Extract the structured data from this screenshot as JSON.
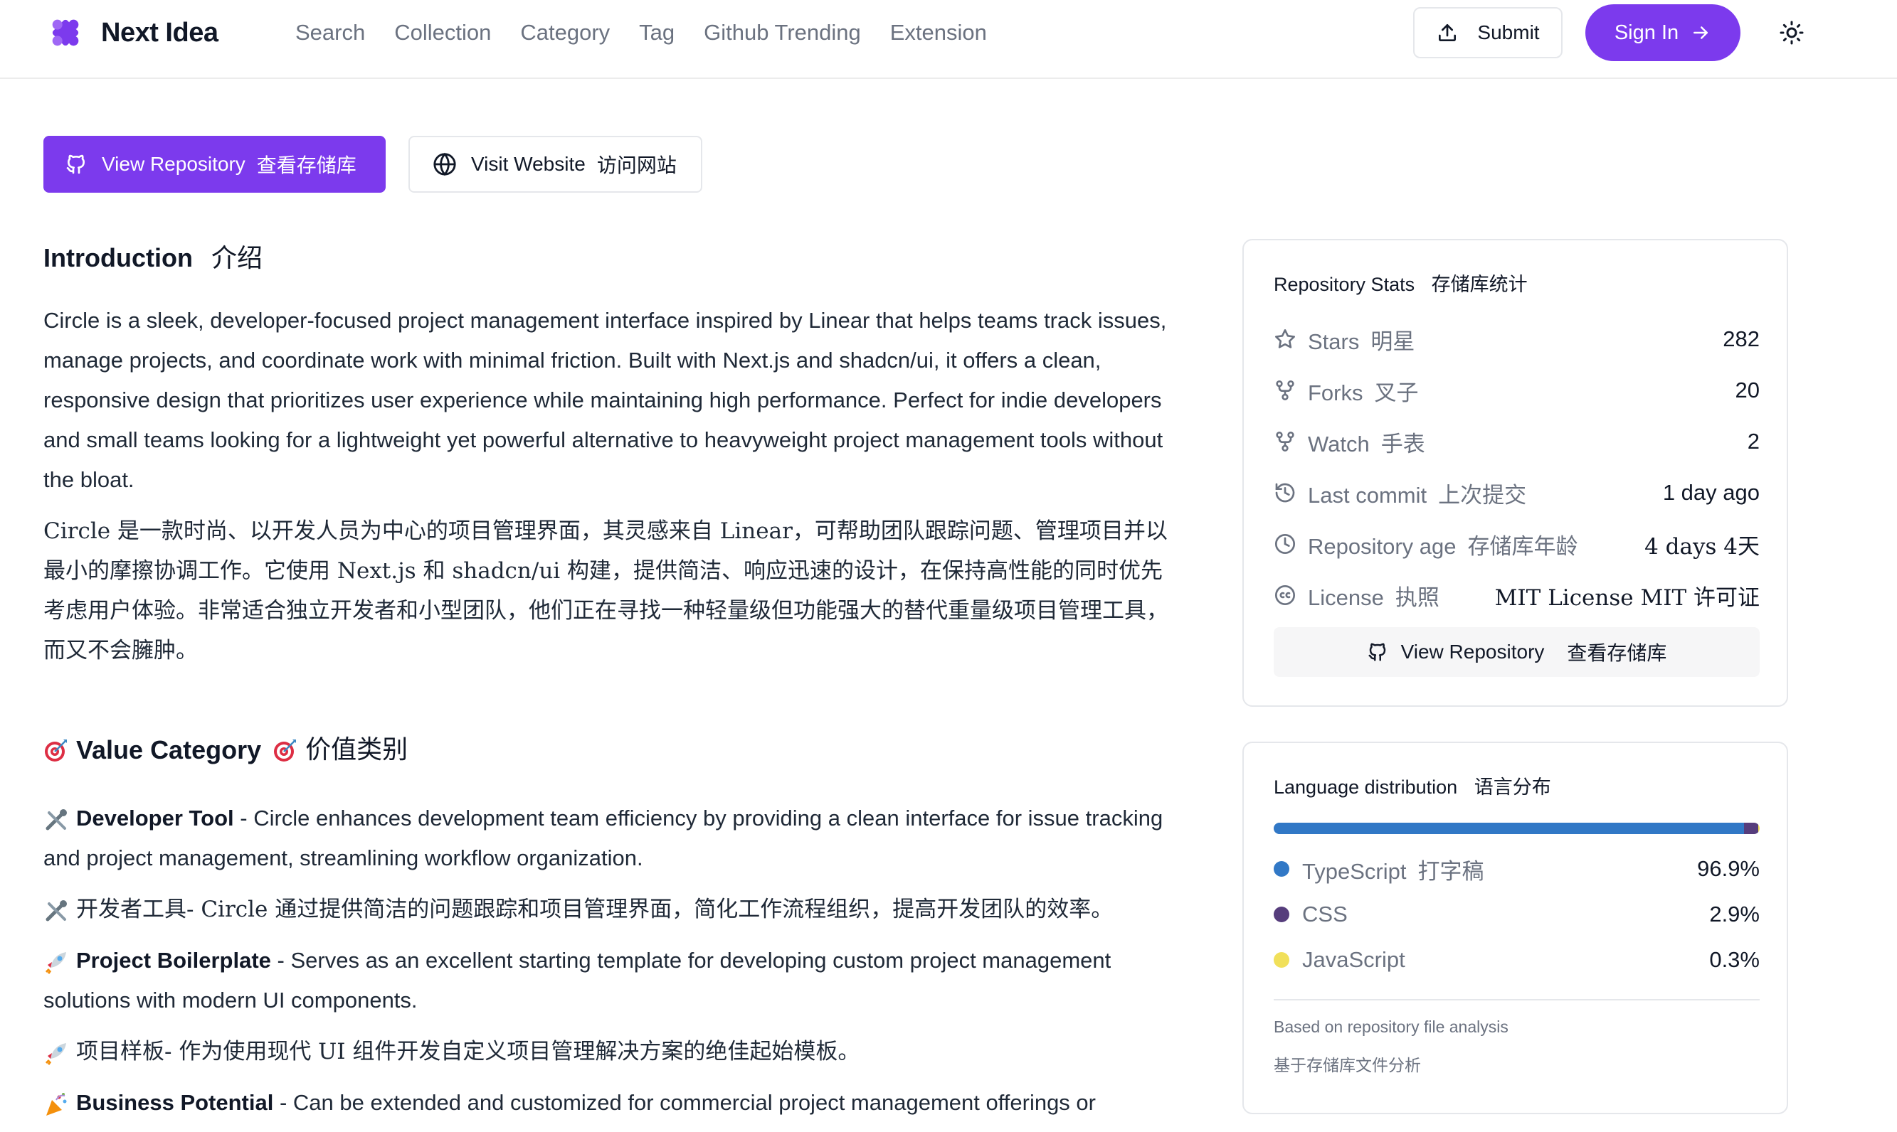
{
  "brand": {
    "name": "Next Idea",
    "accent": "#7c3aed"
  },
  "nav": {
    "items": [
      {
        "label": "Search"
      },
      {
        "label": "Collection"
      },
      {
        "label": "Category"
      },
      {
        "label": "Tag"
      },
      {
        "label": "Github Trending"
      },
      {
        "label": "Extension"
      }
    ]
  },
  "header": {
    "submit_label": "Submit",
    "signin_label": "Sign In",
    "theme_icon": "sun-icon"
  },
  "actions": {
    "view_repo_en": "View Repository",
    "view_repo_cn": "查看存储库",
    "visit_site_en": "Visit Website",
    "visit_site_cn": "访问网站"
  },
  "intro": {
    "heading_en": "Introduction",
    "heading_cn": "介绍",
    "text_en": "Circle is a sleek, developer-focused project management interface inspired by Linear that helps teams track issues, manage projects, and coordinate work with minimal friction. Built with Next.js and shadcn/ui, it offers a clean, responsive design that prioritizes user experience while maintaining high performance. Perfect for indie developers and small teams looking for a lightweight yet powerful alternative to heavyweight project management tools without the bloat.",
    "text_cn": "Circle 是一款时尚、以开发人员为中心的项目管理界面，其灵感来自 Linear，可帮助团队跟踪问题、管理项目并以最小的摩擦协调工作。它使用 Next.js 和 shadcn/ui 构建，提供简洁、响应迅速的设计，在保持高性能的同时优先考虑用户体验。非常适合独立开发者和小型团队，他们正在寻找一种轻量级但功能强大的替代重量级项目管理工具，而又不会臃肿。"
  },
  "value_category": {
    "heading_en": "Value Category",
    "heading_cn": "价值类别",
    "items": [
      {
        "icon": "tools-emoji",
        "title": "Developer Tool",
        "text": " - Circle enhances development team efficiency by providing a clean interface for issue tracking and project management, streamlining workflow organization."
      },
      {
        "icon": "tools-emoji",
        "title": "开发者工具",
        "text": "- Circle 通过提供简洁的问题跟踪和项目管理界面，简化工作流程组织，提高开发团队的效率。"
      },
      {
        "icon": "rocket-emoji",
        "title": "Project Boilerplate",
        "text": " - Serves as an excellent starting template for developing custom project management solutions with modern UI components."
      },
      {
        "icon": "rocket-emoji",
        "title": "项目样板",
        "text": "- 作为使用现代 UI 组件开发自定义项目管理解决方案的绝佳起始模板。"
      },
      {
        "icon": "party-emoji",
        "title": "Business Potential",
        "text": " - Can be extended and customized for commercial project management offerings or"
      }
    ]
  },
  "repo_stats": {
    "title_en": "Repository Stats",
    "title_cn": "存储库统计",
    "rows": [
      {
        "icon": "star-icon",
        "label_en": "Stars",
        "label_cn": "明星",
        "value": "282"
      },
      {
        "icon": "fork-icon",
        "label_en": "Forks",
        "label_cn": "叉子",
        "value": "20"
      },
      {
        "icon": "watch-icon",
        "label_en": "Watch",
        "label_cn": "手表",
        "value": "2"
      },
      {
        "icon": "history-icon",
        "label_en": "Last commit",
        "label_cn": "上次提交",
        "value": "1 day ago"
      },
      {
        "icon": "clock-icon",
        "label_en": "Repository age",
        "label_cn": "存储库年龄",
        "value": "4 days  4天"
      },
      {
        "icon": "license-icon",
        "label_en": "License",
        "label_cn": "执照",
        "value": "MIT License  MIT 许可证"
      }
    ],
    "button_en": "View Repository",
    "button_cn": "查看存储库"
  },
  "languages": {
    "title_en": "Language distribution",
    "title_cn": "语言分布",
    "items": [
      {
        "name_en": "TypeScript",
        "name_cn": "打字稿",
        "percent": 96.9,
        "label": "96.9%",
        "color": "#3178c6"
      },
      {
        "name_en": "CSS",
        "name_cn": "",
        "percent": 2.9,
        "label": "2.9%",
        "color": "#563d7c"
      },
      {
        "name_en": "JavaScript",
        "name_cn": "",
        "percent": 0.3,
        "label": "0.3%",
        "color": "#f1e05a"
      }
    ],
    "note_en": "Based on repository file analysis",
    "note_cn": "基于存储库文件分析"
  }
}
